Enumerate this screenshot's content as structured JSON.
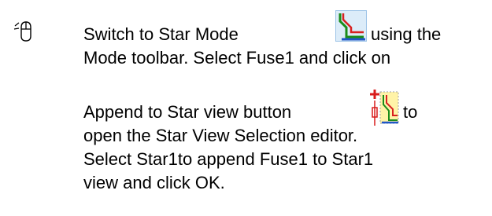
{
  "icons": {
    "mouse": "mouse-icon",
    "star_mode": "star-mode-icon",
    "append_to_star_view": "append-to-star-view-icon"
  },
  "colors": {
    "star_green": "#1a8c1a",
    "star_red": "#d82020",
    "star_blue": "#1f57c7",
    "button_bg": "#dcecf9",
    "button_border": "#9cc3e7",
    "append_bg": "#fff3a8",
    "append_red": "#d81c1c"
  },
  "instruction": {
    "line1_a": "Switch to Star Mode",
    "line1_b": "using the",
    "line2": "Mode toolbar. Select Fuse1 and click on",
    "line3_a": "Append to Star view button",
    "line3_b": "to",
    "line4": "open the Star View Selection editor.",
    "line5": "Select Star1to append Fuse1 to Star1",
    "line6": "view and click OK."
  }
}
